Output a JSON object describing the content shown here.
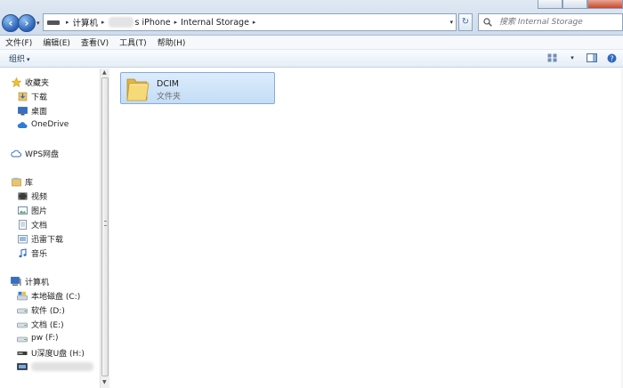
{
  "address": {
    "crumbs": [
      "计算机",
      "s iPhone",
      "Internal Storage"
    ]
  },
  "search": {
    "placeholder": "搜索 Internal Storage"
  },
  "menu": [
    "文件(F)",
    "编辑(E)",
    "查看(V)",
    "工具(T)",
    "帮助(H)"
  ],
  "toolbar": {
    "organize": "组织"
  },
  "navpane": {
    "favorites": {
      "label": "收藏夹",
      "items": [
        "下载",
        "桌面",
        "OneDrive"
      ]
    },
    "wps": "WPS网盘",
    "libraries": {
      "label": "库",
      "items": [
        "视频",
        "图片",
        "文档",
        "迅雷下载",
        "音乐"
      ]
    },
    "computer": {
      "label": "计算机",
      "items": [
        "本地磁盘 (C:)",
        "软件 (D:)",
        "文档 (E:)",
        "pw (F:)",
        "U深度U盘 (H:)"
      ]
    }
  },
  "content": {
    "items": [
      {
        "name": "DCIM",
        "type": "文件夹"
      }
    ]
  },
  "colors": {
    "accent": "#3a6fb5",
    "selection": "#cde4fb",
    "folder": "#f5d76e"
  }
}
